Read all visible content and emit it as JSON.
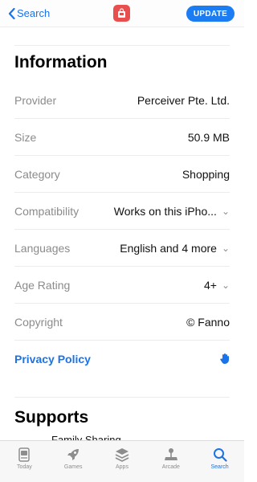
{
  "nav": {
    "back_label": "Search",
    "update_label": "UPDATE"
  },
  "information": {
    "title": "Information",
    "rows": [
      {
        "label": "Provider",
        "value": "Perceiver Pte. Ltd."
      },
      {
        "label": "Size",
        "value": "50.9 MB"
      },
      {
        "label": "Category",
        "value": "Shopping"
      },
      {
        "label": "Compatibility",
        "value": "Works on this iPho..."
      },
      {
        "label": "Languages",
        "value": "English and 4 more"
      },
      {
        "label": "Age Rating",
        "value": "4+"
      },
      {
        "label": "Copyright",
        "value": "© Fanno"
      }
    ],
    "privacy_label": "Privacy Policy"
  },
  "supports": {
    "title": "Supports",
    "first_item": "Family Sharing"
  },
  "tabbar": {
    "tabs": [
      {
        "label": "Today",
        "icon": "today-icon"
      },
      {
        "label": "Games",
        "icon": "rocket-icon"
      },
      {
        "label": "Apps",
        "icon": "apps-stack-icon"
      },
      {
        "label": "Arcade",
        "icon": "joystick-icon"
      },
      {
        "label": "Search",
        "icon": "search-icon"
      }
    ],
    "active_tab": "Search"
  },
  "colors": {
    "accent": "#1a73e8",
    "update_button": "#1c7cf2",
    "app_icon": "#e8504f"
  }
}
